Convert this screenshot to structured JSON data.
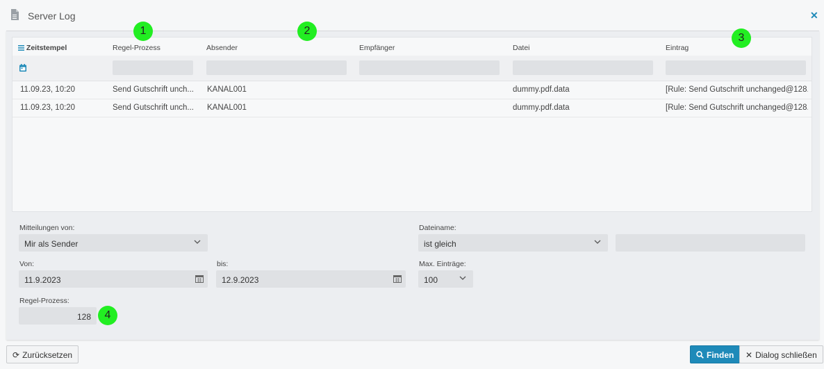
{
  "window": {
    "title": "Server Log",
    "close_icon": "close-icon",
    "doc_icon": "document-icon"
  },
  "grid": {
    "headers": [
      "Zeitstempel",
      "Regel-Prozess",
      "Absender",
      "Empfänger",
      "Datei",
      "Eintrag"
    ],
    "sort_icon": "sort-lines-icon",
    "filter_icon": "calendar-icon",
    "rows": [
      [
        "11.09.23, 10:20",
        "Send Gutschrift unch...",
        "KANAL001",
        "",
        "dummy.pdf.data",
        "[Rule: Send Gutschrift unchanged@128..."
      ],
      [
        "11.09.23, 10:20",
        "Send Gutschrift unch...",
        "KANAL001",
        "",
        "dummy.pdf.data",
        "[Rule: Send Gutschrift unchanged@128..."
      ]
    ]
  },
  "form": {
    "mitteilungen_label": "Mitteilungen von:",
    "mitteilungen_value": "Mir als Sender",
    "dateiname_label": "Dateiname:",
    "dateiname_op": "ist gleich",
    "dateiname_value": "",
    "von_label": "Von:",
    "von_value": "11.9.2023",
    "bis_label": "bis:",
    "bis_value": "12.9.2023",
    "max_label": "Max. Einträge:",
    "max_value": "100",
    "regel_label": "Regel-Prozess:",
    "regel_value": "128"
  },
  "markers": [
    "1",
    "2",
    "3",
    "4"
  ],
  "buttons": {
    "reset": "Zurücksetzen",
    "find": "Finden",
    "close": "Dialog schließen"
  },
  "colors": {
    "accent": "#1e8ab9",
    "marker": "#22ee22"
  }
}
